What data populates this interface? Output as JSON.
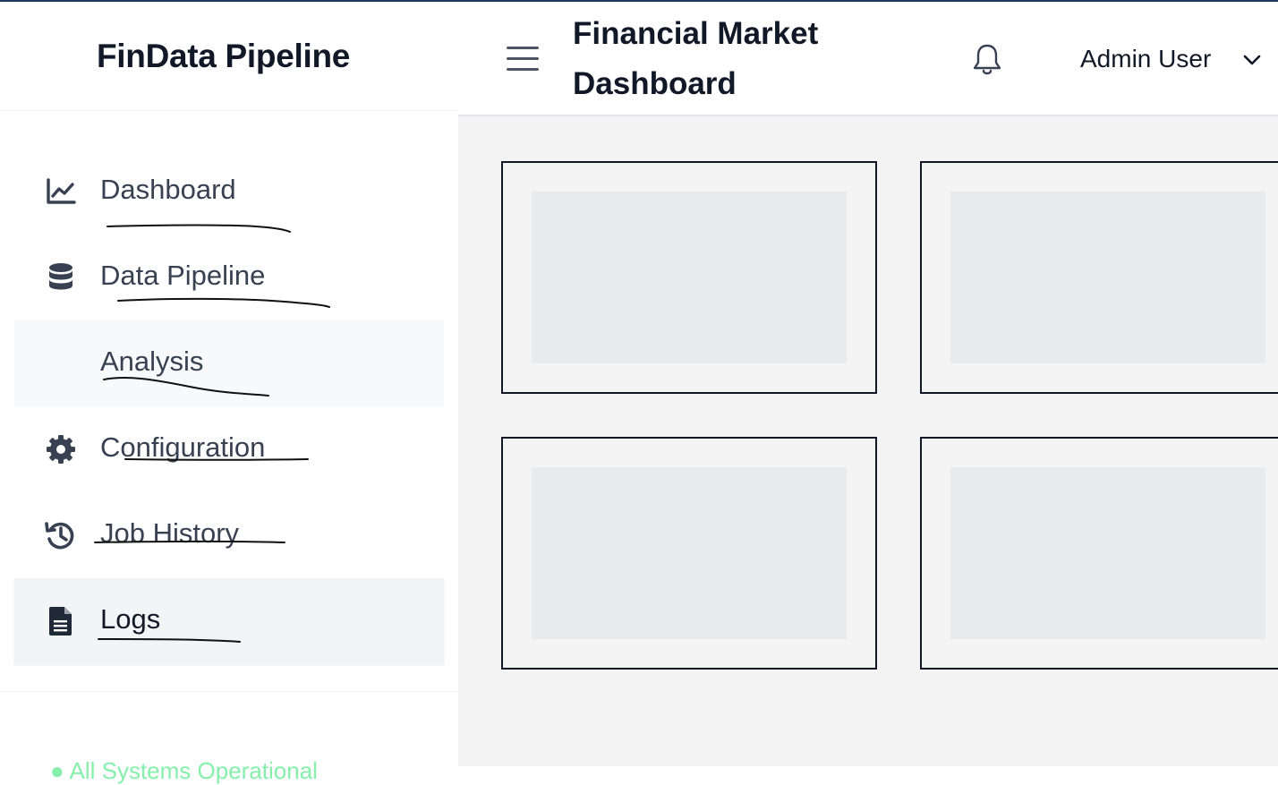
{
  "app": {
    "brand": "FinData Pipeline"
  },
  "sidebar": {
    "items": [
      {
        "label": "Dashboard",
        "icon": "chart-line-icon"
      },
      {
        "label": "Data Pipeline",
        "icon": "database-icon"
      },
      {
        "label": "Analysis",
        "icon": ""
      },
      {
        "label": "Configuration",
        "icon": "gear-icon"
      },
      {
        "label": "Job History",
        "icon": "history-icon"
      },
      {
        "label": "Logs",
        "icon": "file-text-icon"
      }
    ],
    "status": "● All Systems Operational"
  },
  "header": {
    "title": "Financial Market Dashboard",
    "user": "Admin User",
    "icons": [
      "menu-icon",
      "bell-icon",
      "chevron-down-icon"
    ]
  },
  "colors": {
    "accent_topline": "#1e3a5f",
    "text": "#111827",
    "nav_text": "#374151",
    "main_bg": "#f4f4f5",
    "status_green": "#86efac"
  }
}
